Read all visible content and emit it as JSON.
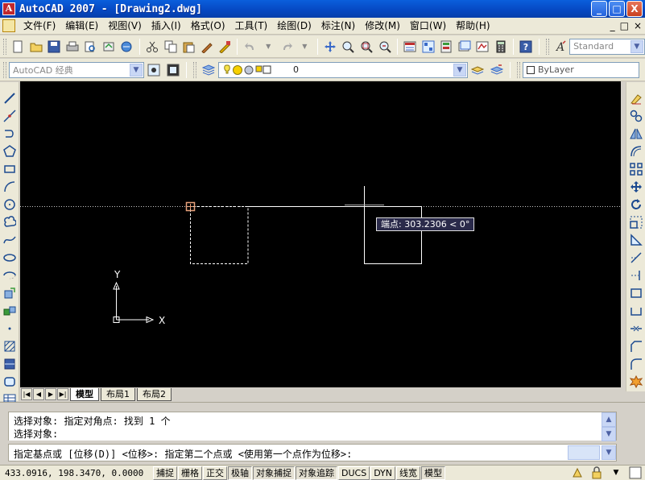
{
  "window": {
    "title": "AutoCAD 2007 - [Drawing2.dwg]",
    "buttons": {
      "minimize": "_",
      "maximize": "□",
      "close": "X"
    }
  },
  "menu": {
    "items": [
      "文件(F)",
      "编辑(E)",
      "视图(V)",
      "插入(I)",
      "格式(O)",
      "工具(T)",
      "绘图(D)",
      "标注(N)",
      "修改(M)",
      "窗口(W)",
      "帮助(H)"
    ],
    "doc_buttons": {
      "minimize": "_",
      "restore": "□",
      "close": "×"
    }
  },
  "toolbar": {
    "text_style": "Standard",
    "workspace": "AutoCAD 经典",
    "layer_value": "0",
    "linetype_value": "ByLayer"
  },
  "canvas": {
    "background": "#000000",
    "tooltip_label": "端点: 303.2306 < 0°",
    "ucs_x_label": "X",
    "ucs_y_label": "Y"
  },
  "tabs": {
    "nav": [
      "|◀",
      "◀",
      "▶",
      "▶|"
    ],
    "items": [
      "模型",
      "布局1",
      "布局2"
    ],
    "active": "模型"
  },
  "command": {
    "history": [
      "选择对象: 指定对角点: 找到 1 个",
      "选择对象:"
    ],
    "prompt": "指定基点或 [位移(D)] <位移>:  指定第二个点或 <使用第一个点作为位移>:"
  },
  "status": {
    "coordinates": "433.0916, 198.3470, 0.0000",
    "toggles": [
      {
        "label": "捕捉",
        "on": false
      },
      {
        "label": "栅格",
        "on": false
      },
      {
        "label": "正交",
        "on": false
      },
      {
        "label": "极轴",
        "on": true
      },
      {
        "label": "对象捕捉",
        "on": true
      },
      {
        "label": "对象追踪",
        "on": true
      },
      {
        "label": "DUCS",
        "on": false
      },
      {
        "label": "DYN",
        "on": false
      },
      {
        "label": "线宽",
        "on": false
      },
      {
        "label": "模型",
        "on": true
      }
    ]
  },
  "colors": {
    "title_bar": "#0a5fdc",
    "canvas": "#000000",
    "tooltip_bg": "#2a2a4a",
    "tracking_line": "#c8c8c8",
    "osnap_marker": "#e7a07a"
  }
}
